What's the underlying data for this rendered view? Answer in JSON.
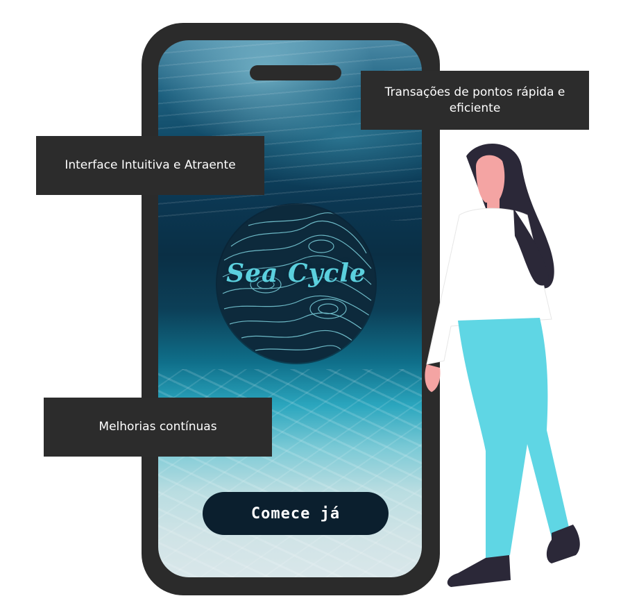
{
  "app": {
    "logo_text": "Sea Cycle",
    "cta_label": "Comece já"
  },
  "callouts": {
    "top_right": "Transações de pontos rápida e eficiente",
    "left_upper": "Interface Intuitiva e Atraente",
    "left_lower": "Melhorias contínuas"
  },
  "colors": {
    "phone_frame": "#2b2b2b",
    "callout_bg": "#2c2c2c",
    "button_bg": "#0b1f2e",
    "logo_accent": "#5bd0de",
    "pants": "#5fd6e4",
    "hair": "#2b2838",
    "skin": "#f4a4a3"
  },
  "icons": {
    "logo": "topographic-circle-logo",
    "illustration": "woman-standing-illustration"
  }
}
